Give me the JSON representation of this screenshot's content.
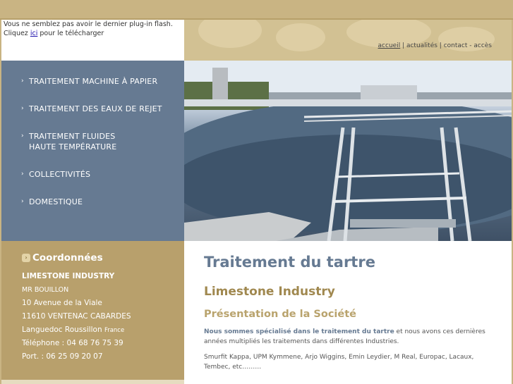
{
  "flash_notice": {
    "text_before": "Vous ne semblez pas avoir le dernier plug-in flash. Cliquez",
    "link": "ici",
    "text_after": " pour le télécharger"
  },
  "top_links": {
    "accueil": "accueil",
    "sep": " | ",
    "actualites": "actualités",
    "contact": "contact - accès"
  },
  "nav": {
    "items": [
      {
        "label": "TRAITEMENT MACHINE À PAPIER"
      },
      {
        "label": "TRAITEMENT DES EAUX DE REJET"
      },
      {
        "label": "TRAITEMENT FLUIDES",
        "label2": "HAUTE TEMPÉRATURE"
      },
      {
        "label": "COLLECTIVITÉS"
      },
      {
        "label": "DOMESTIQUE"
      }
    ]
  },
  "coordinates": {
    "title": "Coordonnées",
    "company": "LIMESTONE INDUSTRY",
    "contact": "MR BOUILLON",
    "address1": "10 Avenue de la Viale",
    "address2": "11610 VENTENAC CABARDES",
    "region": "Languedoc Roussillon",
    "country": "France",
    "phone": "Téléphone : 04 68 76 75 39",
    "mobile": "Port. : 06 25 09 20 07"
  },
  "content": {
    "title": "Traitement du tartre",
    "subtitle": "Limestone Industry",
    "section": "Présentation de la Société",
    "intro_bold": "Nous sommes spécialisé dans le traitement du tartre",
    "intro_rest": " et nous avons ces dernières années multipliés les traitements dans différentes Industries.",
    "clients": "Smurfit Kappa, UPM Kymmene, Arjo Wiggins, Emin Leydier, M Real, Europac, Lacaux, Tembec, etc………"
  },
  "colors": {
    "nav_bg": "#667a92",
    "gold": "#b8a06c",
    "title_blue": "#667a92",
    "subtitle_gold": "#a0884f"
  }
}
